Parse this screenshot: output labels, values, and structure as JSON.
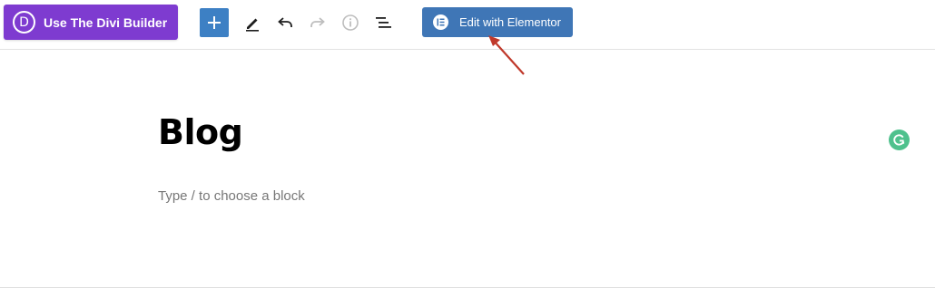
{
  "toolbar": {
    "divi_button_label": "Use The Divi Builder",
    "divi_logo_letter": "D",
    "elementor_button_label": "Edit with Elementor",
    "colors": {
      "divi_purple": "#7e3bd0",
      "add_blue": "#3d80c4",
      "elementor_blue": "#3f76b6"
    },
    "tools": [
      {
        "name": "add-block",
        "icon": "plus-icon"
      },
      {
        "name": "tools",
        "icon": "pencil-icon"
      },
      {
        "name": "undo",
        "icon": "undo-icon"
      },
      {
        "name": "redo",
        "icon": "redo-icon",
        "disabled": true
      },
      {
        "name": "details",
        "icon": "info-icon"
      },
      {
        "name": "list-view",
        "icon": "list-view-icon"
      }
    ]
  },
  "editor": {
    "title": "Blog",
    "block_placeholder": "Type / to choose a block"
  },
  "annotation": {
    "arrow_color": "#c0392b"
  },
  "grammarly": {
    "icon": "grammarly-icon",
    "color": "#4fc18d"
  }
}
